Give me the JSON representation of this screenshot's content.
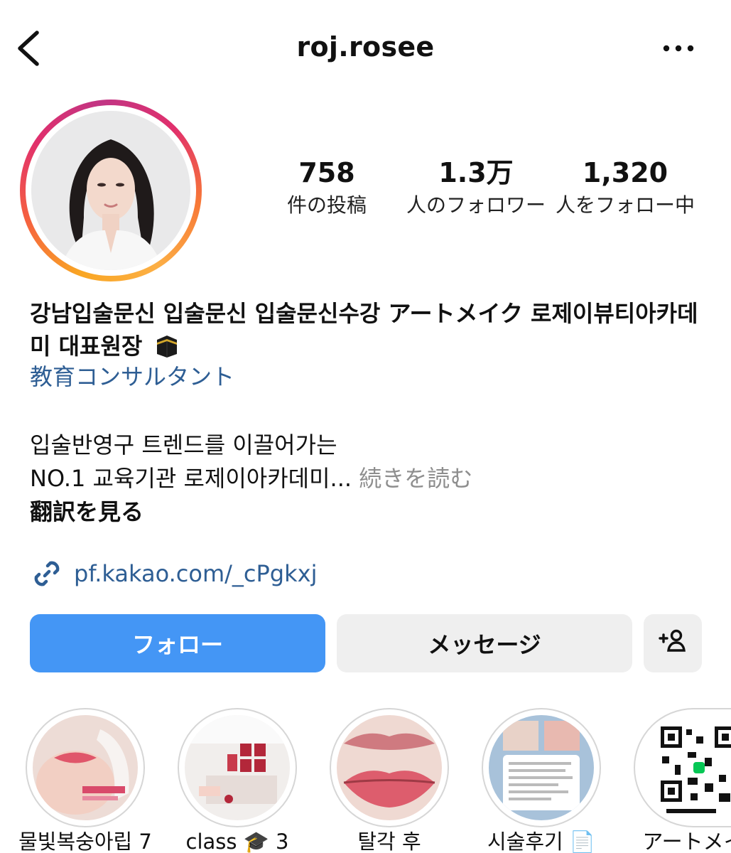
{
  "header": {
    "username": "roj.rosee",
    "back_icon": "chevron-left-icon",
    "more_icon": "more-horizontal-icon"
  },
  "stats": {
    "posts": {
      "value": "758",
      "label": "件の投稿"
    },
    "followers": {
      "value": "1.3万",
      "label": "人のフォロワー"
    },
    "following": {
      "value": "1,320",
      "label": "人をフォロー中"
    }
  },
  "bio": {
    "name_line": "강남입술문신 입술문신 입술문신수강 アートメイク 로제이뷰티아카데미 대표원장",
    "name_emoji": "kaaba-emoji-icon",
    "category": "教育コンサルタント",
    "line1": "입술반영구 트렌드를 이끌어가는",
    "line2": "NO.1 교육기관 로제이아카데미...",
    "more_label": "続きを読む",
    "translate_label": "翻訳を見る"
  },
  "link": {
    "icon": "link-icon",
    "text": "pf.kakao.com/_cPgkxj"
  },
  "actions": {
    "follow_label": "フォロー",
    "message_label": "メッセージ",
    "add_user_icon": "add-user-icon"
  },
  "highlights": [
    {
      "label": "물빛복숭아립 7",
      "thumb": "lip-procedure-photo"
    },
    {
      "label": "class 🎓 3",
      "thumb": "classroom-photo"
    },
    {
      "label": "탈각 후",
      "thumb": "lips-closeup-photo"
    },
    {
      "label": "시술후기 📄",
      "thumb": "review-chat-photo"
    },
    {
      "label": "アートメイ",
      "thumb": "qr-code-image"
    }
  ],
  "colors": {
    "link_blue": "#2e5e94",
    "follow_blue": "#4496f5",
    "secondary_button": "#efefef",
    "muted_text": "#8e8e8e"
  }
}
